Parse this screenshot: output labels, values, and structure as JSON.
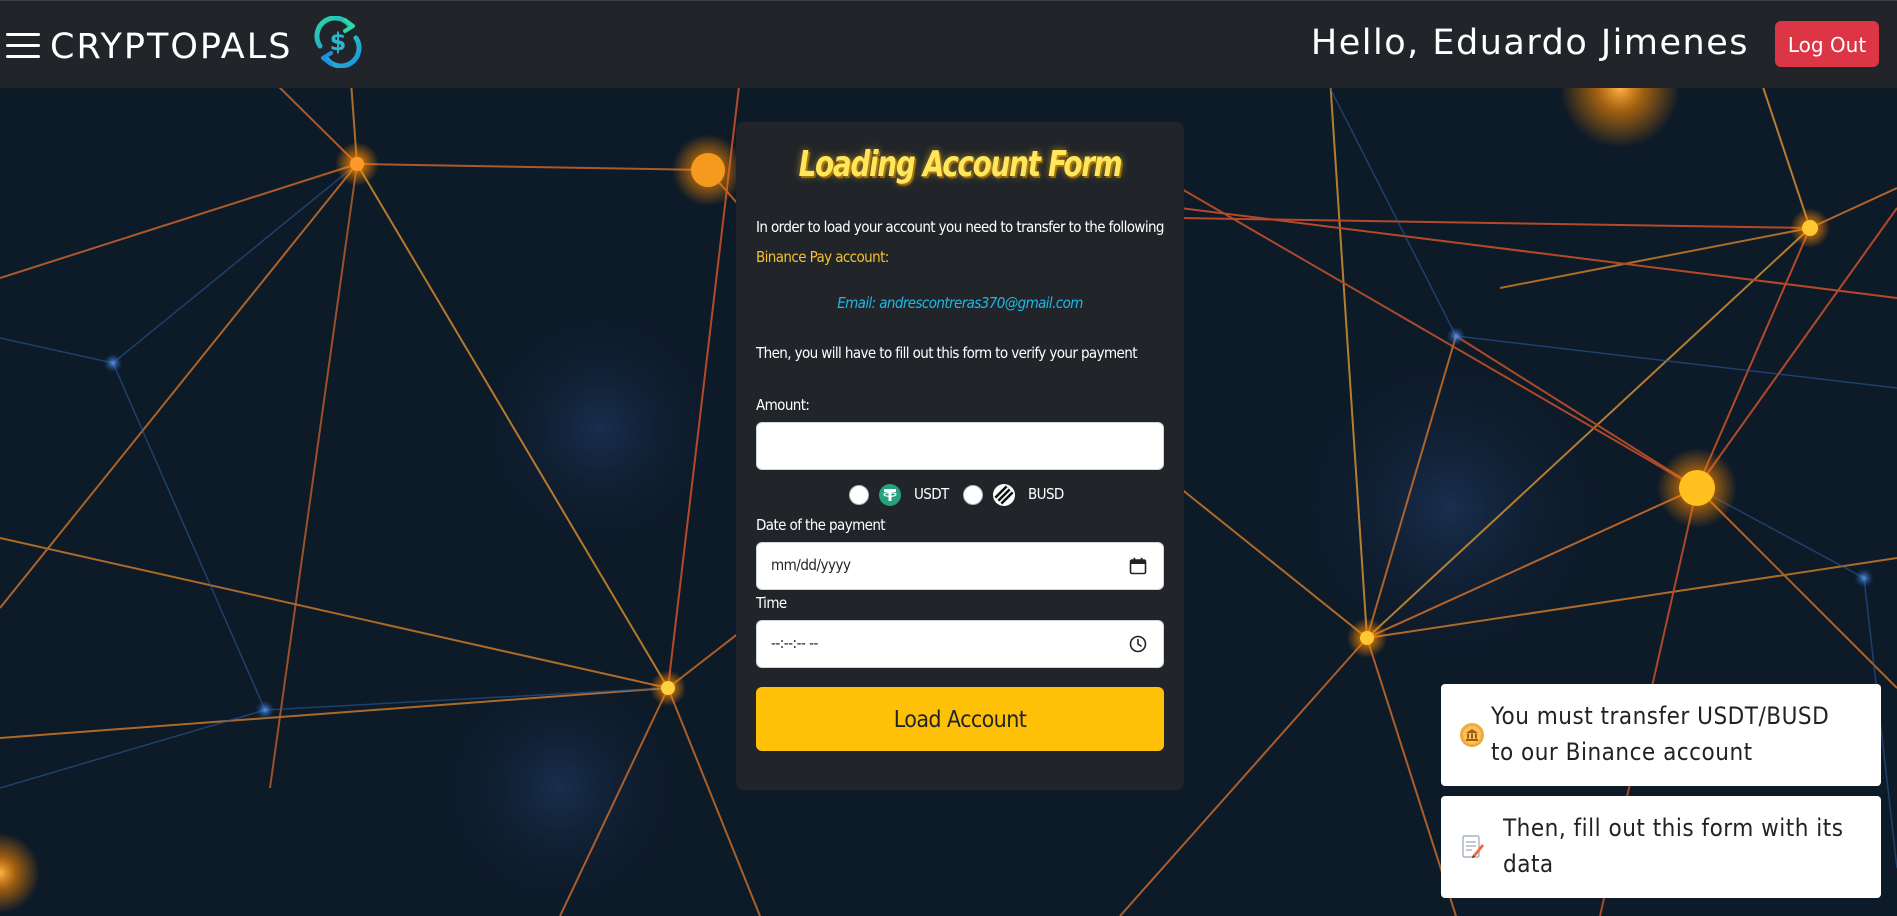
{
  "navbar": {
    "brand": "CRYPTOPALS",
    "greeting": "Hello, Eduardo Jimenes",
    "logout_label": "Log Out"
  },
  "icons": {
    "menu": "hamburger-icon",
    "logo": "dollar-exchange-icon",
    "calendar": "calendar-icon",
    "clock": "clock-icon",
    "bank": "bank-coin-icon",
    "notepad": "notepad-icon"
  },
  "form": {
    "title": "Loading Account Form",
    "intro": "In order to load your account you need to transfer to the following",
    "intro_accent": "Binance Pay account:",
    "email": "Email: andrescontreras370@gmail.com",
    "instruction": "Then, you will have to fill out this form to verify your payment",
    "amount_label": "Amount:",
    "amount_value": "",
    "currencies": [
      {
        "label": "USDT",
        "selected": false
      },
      {
        "label": "BUSD",
        "selected": false
      }
    ],
    "date_label": "Date of the payment",
    "date_placeholder": "mm/dd/yyyy",
    "time_label": "Time",
    "time_placeholder": "--:--:-- --",
    "submit_label": "Load Account"
  },
  "notifications": [
    {
      "text": "You must transfer USDT/BUSD to our Binance account"
    },
    {
      "text": "Then, fill out this form with its data"
    }
  ],
  "colors": {
    "navbar": "#212529",
    "danger": "#dc3545",
    "warning": "#ffc107",
    "title": "#ffe65a",
    "accent": "#f5c12c",
    "email": "#1eb8e6",
    "usdt": "#26a17b"
  }
}
